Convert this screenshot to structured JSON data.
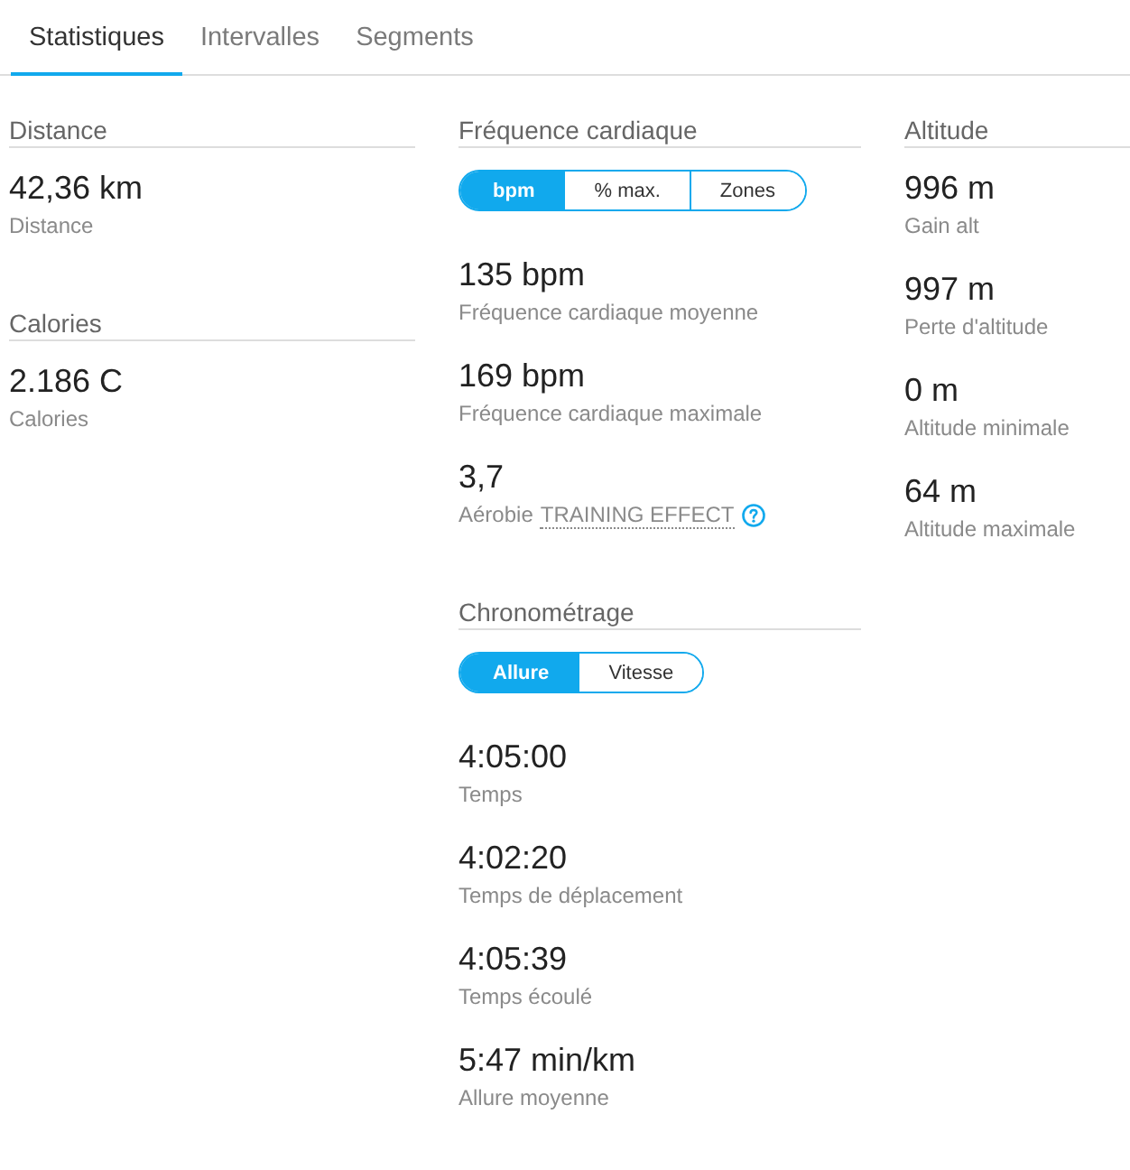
{
  "tabs": [
    {
      "label": "Statistiques",
      "selected": true
    },
    {
      "label": "Intervalles",
      "selected": false
    },
    {
      "label": "Segments",
      "selected": false
    }
  ],
  "columns": [
    {
      "sections": [
        {
          "title": "Distance",
          "stats": [
            {
              "value": "42,36 km",
              "label": "Distance"
            }
          ]
        },
        {
          "title": "Calories",
          "stats": [
            {
              "value": "2.186 C",
              "label": "Calories"
            }
          ]
        }
      ]
    },
    {
      "sections": [
        {
          "title": "Fréquence cardiaque",
          "toggle": [
            {
              "label": "bpm",
              "selected": true
            },
            {
              "label": "% max.",
              "selected": false
            },
            {
              "label": "Zones",
              "selected": false
            }
          ],
          "stats": [
            {
              "value": "135 bpm",
              "label": "Fréquence cardiaque moyenne"
            },
            {
              "value": "169 bpm",
              "label": "Fréquence cardiaque maximale"
            },
            {
              "value": "3,7",
              "label": "Aérobie",
              "link": "TRAINING EFFECT"
            }
          ]
        },
        {
          "title": "Chronométrage",
          "toggle": [
            {
              "label": "Allure",
              "selected": true
            },
            {
              "label": "Vitesse",
              "selected": false
            }
          ],
          "stats": [
            {
              "value": "4:05:00",
              "label": "Temps"
            },
            {
              "value": "4:02:20",
              "label": "Temps de déplacement"
            },
            {
              "value": "4:05:39",
              "label": "Temps écoulé"
            },
            {
              "value": "5:47 min/km",
              "label": "Allure moyenne"
            }
          ]
        }
      ]
    },
    {
      "sections": [
        {
          "title": "Altitude",
          "stats": [
            {
              "value": "996 m",
              "label": "Gain alt"
            },
            {
              "value": "997 m",
              "label": "Perte d'altitude"
            },
            {
              "value": "0 m",
              "label": "Altitude minimale"
            },
            {
              "value": "64 m",
              "label": "Altitude maximale"
            }
          ]
        }
      ]
    }
  ]
}
